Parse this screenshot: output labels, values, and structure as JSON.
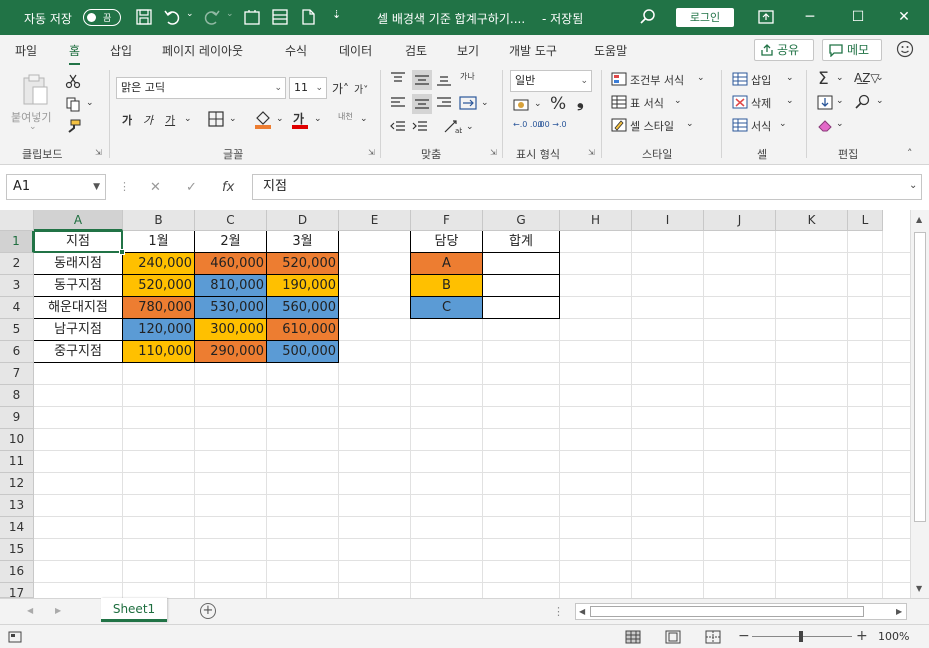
{
  "titlebar": {
    "autosave_label": "자동 저장",
    "autosave_state": "끔",
    "doc_title": "셀 배경색 기준 합계구하기....",
    "save_status": "- 저장됨",
    "login_label": "로그인"
  },
  "tabs": [
    "파일",
    "홈",
    "삽입",
    "페이지 레이아웃",
    "수식",
    "데이터",
    "검토",
    "보기",
    "개발 도구",
    "도움말"
  ],
  "share_label": "공유",
  "memo_label": "메모",
  "ribbon": {
    "paste_label": "붙여넣기",
    "font_name": "맑은 고딕",
    "font_size": "11",
    "number_format": "일반",
    "conditional_format": "조건부 서식",
    "table_format": "표 서식",
    "cell_style": "셀 스타일",
    "insert": "삽입",
    "delete": "삭제",
    "format": "서식",
    "groups": {
      "clipboard": "클립보드",
      "font": "글꼴",
      "alignment": "맞춤",
      "number": "표시 형식",
      "styles": "스타일",
      "cells": "셀",
      "editing": "편집"
    }
  },
  "formula_bar": {
    "name_box": "A1",
    "fx": "fx",
    "content": "지점"
  },
  "columns": [
    "A",
    "B",
    "C",
    "D",
    "E",
    "F",
    "G",
    "H",
    "I",
    "J",
    "K",
    "L"
  ],
  "rows": [
    "1",
    "2",
    "3",
    "4",
    "5",
    "6",
    "7",
    "8",
    "9",
    "10",
    "11",
    "12",
    "13",
    "14",
    "15",
    "16",
    "17"
  ],
  "colors": {
    "orange": "#ED7D31",
    "yellow": "#FFC000",
    "blue": "#5B9BD5",
    "excel_green": "#217346"
  },
  "table": {
    "headers": [
      "지점",
      "1월",
      "2월",
      "3월"
    ],
    "rows": [
      {
        "branch": "동래지점",
        "values": [
          "240,000",
          "460,000",
          "520,000"
        ],
        "colors": [
          "yellow",
          "orange",
          "orange"
        ]
      },
      {
        "branch": "동구지점",
        "values": [
          "520,000",
          "810,000",
          "190,000"
        ],
        "colors": [
          "yellow",
          "blue",
          "yellow"
        ]
      },
      {
        "branch": "해운대지점",
        "values": [
          "780,000",
          "530,000",
          "560,000"
        ],
        "colors": [
          "orange",
          "blue",
          "blue"
        ]
      },
      {
        "branch": "남구지점",
        "values": [
          "120,000",
          "300,000",
          "610,000"
        ],
        "colors": [
          "blue",
          "yellow",
          "orange"
        ]
      },
      {
        "branch": "중구지점",
        "values": [
          "110,000",
          "290,000",
          "500,000"
        ],
        "colors": [
          "yellow",
          "orange",
          "blue"
        ]
      }
    ]
  },
  "summary": {
    "headers": [
      "담당",
      "합계"
    ],
    "rows": [
      {
        "label": "A",
        "color": "orange",
        "total": ""
      },
      {
        "label": "B",
        "color": "yellow",
        "total": ""
      },
      {
        "label": "C",
        "color": "blue",
        "total": ""
      }
    ]
  },
  "sheet_tab": "Sheet1",
  "status": {
    "zoom": "100%"
  }
}
